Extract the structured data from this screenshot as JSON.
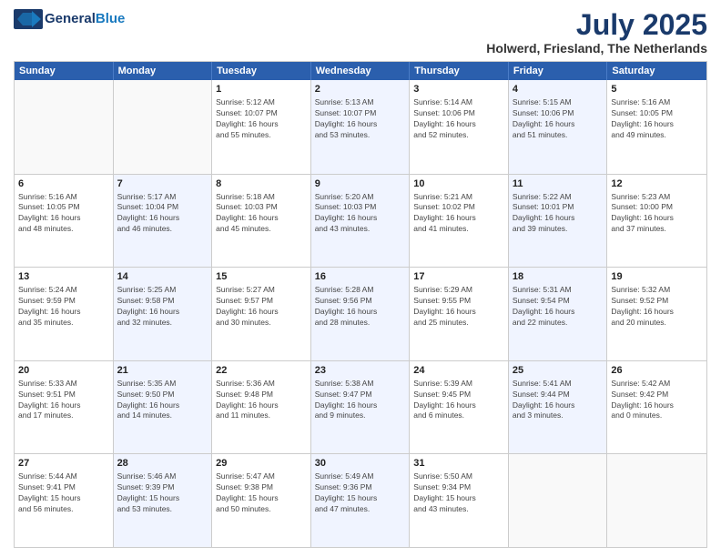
{
  "header": {
    "logo_general": "General",
    "logo_blue": "Blue",
    "month_title": "July 2025",
    "location": "Holwerd, Friesland, The Netherlands"
  },
  "weekdays": [
    "Sunday",
    "Monday",
    "Tuesday",
    "Wednesday",
    "Thursday",
    "Friday",
    "Saturday"
  ],
  "rows": [
    [
      {
        "num": "",
        "text": "",
        "empty": true
      },
      {
        "num": "",
        "text": "",
        "empty": true
      },
      {
        "num": "1",
        "text": "Sunrise: 5:12 AM\nSunset: 10:07 PM\nDaylight: 16 hours\nand 55 minutes.",
        "shade": false
      },
      {
        "num": "2",
        "text": "Sunrise: 5:13 AM\nSunset: 10:07 PM\nDaylight: 16 hours\nand 53 minutes.",
        "shade": true
      },
      {
        "num": "3",
        "text": "Sunrise: 5:14 AM\nSunset: 10:06 PM\nDaylight: 16 hours\nand 52 minutes.",
        "shade": false
      },
      {
        "num": "4",
        "text": "Sunrise: 5:15 AM\nSunset: 10:06 PM\nDaylight: 16 hours\nand 51 minutes.",
        "shade": true
      },
      {
        "num": "5",
        "text": "Sunrise: 5:16 AM\nSunset: 10:05 PM\nDaylight: 16 hours\nand 49 minutes.",
        "shade": false
      }
    ],
    [
      {
        "num": "6",
        "text": "Sunrise: 5:16 AM\nSunset: 10:05 PM\nDaylight: 16 hours\nand 48 minutes.",
        "shade": false
      },
      {
        "num": "7",
        "text": "Sunrise: 5:17 AM\nSunset: 10:04 PM\nDaylight: 16 hours\nand 46 minutes.",
        "shade": true
      },
      {
        "num": "8",
        "text": "Sunrise: 5:18 AM\nSunset: 10:03 PM\nDaylight: 16 hours\nand 45 minutes.",
        "shade": false
      },
      {
        "num": "9",
        "text": "Sunrise: 5:20 AM\nSunset: 10:03 PM\nDaylight: 16 hours\nand 43 minutes.",
        "shade": true
      },
      {
        "num": "10",
        "text": "Sunrise: 5:21 AM\nSunset: 10:02 PM\nDaylight: 16 hours\nand 41 minutes.",
        "shade": false
      },
      {
        "num": "11",
        "text": "Sunrise: 5:22 AM\nSunset: 10:01 PM\nDaylight: 16 hours\nand 39 minutes.",
        "shade": true
      },
      {
        "num": "12",
        "text": "Sunrise: 5:23 AM\nSunset: 10:00 PM\nDaylight: 16 hours\nand 37 minutes.",
        "shade": false
      }
    ],
    [
      {
        "num": "13",
        "text": "Sunrise: 5:24 AM\nSunset: 9:59 PM\nDaylight: 16 hours\nand 35 minutes.",
        "shade": false
      },
      {
        "num": "14",
        "text": "Sunrise: 5:25 AM\nSunset: 9:58 PM\nDaylight: 16 hours\nand 32 minutes.",
        "shade": true
      },
      {
        "num": "15",
        "text": "Sunrise: 5:27 AM\nSunset: 9:57 PM\nDaylight: 16 hours\nand 30 minutes.",
        "shade": false
      },
      {
        "num": "16",
        "text": "Sunrise: 5:28 AM\nSunset: 9:56 PM\nDaylight: 16 hours\nand 28 minutes.",
        "shade": true
      },
      {
        "num": "17",
        "text": "Sunrise: 5:29 AM\nSunset: 9:55 PM\nDaylight: 16 hours\nand 25 minutes.",
        "shade": false
      },
      {
        "num": "18",
        "text": "Sunrise: 5:31 AM\nSunset: 9:54 PM\nDaylight: 16 hours\nand 22 minutes.",
        "shade": true
      },
      {
        "num": "19",
        "text": "Sunrise: 5:32 AM\nSunset: 9:52 PM\nDaylight: 16 hours\nand 20 minutes.",
        "shade": false
      }
    ],
    [
      {
        "num": "20",
        "text": "Sunrise: 5:33 AM\nSunset: 9:51 PM\nDaylight: 16 hours\nand 17 minutes.",
        "shade": false
      },
      {
        "num": "21",
        "text": "Sunrise: 5:35 AM\nSunset: 9:50 PM\nDaylight: 16 hours\nand 14 minutes.",
        "shade": true
      },
      {
        "num": "22",
        "text": "Sunrise: 5:36 AM\nSunset: 9:48 PM\nDaylight: 16 hours\nand 11 minutes.",
        "shade": false
      },
      {
        "num": "23",
        "text": "Sunrise: 5:38 AM\nSunset: 9:47 PM\nDaylight: 16 hours\nand 9 minutes.",
        "shade": true
      },
      {
        "num": "24",
        "text": "Sunrise: 5:39 AM\nSunset: 9:45 PM\nDaylight: 16 hours\nand 6 minutes.",
        "shade": false
      },
      {
        "num": "25",
        "text": "Sunrise: 5:41 AM\nSunset: 9:44 PM\nDaylight: 16 hours\nand 3 minutes.",
        "shade": true
      },
      {
        "num": "26",
        "text": "Sunrise: 5:42 AM\nSunset: 9:42 PM\nDaylight: 16 hours\nand 0 minutes.",
        "shade": false
      }
    ],
    [
      {
        "num": "27",
        "text": "Sunrise: 5:44 AM\nSunset: 9:41 PM\nDaylight: 15 hours\nand 56 minutes.",
        "shade": false
      },
      {
        "num": "28",
        "text": "Sunrise: 5:46 AM\nSunset: 9:39 PM\nDaylight: 15 hours\nand 53 minutes.",
        "shade": true
      },
      {
        "num": "29",
        "text": "Sunrise: 5:47 AM\nSunset: 9:38 PM\nDaylight: 15 hours\nand 50 minutes.",
        "shade": false
      },
      {
        "num": "30",
        "text": "Sunrise: 5:49 AM\nSunset: 9:36 PM\nDaylight: 15 hours\nand 47 minutes.",
        "shade": true
      },
      {
        "num": "31",
        "text": "Sunrise: 5:50 AM\nSunset: 9:34 PM\nDaylight: 15 hours\nand 43 minutes.",
        "shade": false
      },
      {
        "num": "",
        "text": "",
        "empty": true
      },
      {
        "num": "",
        "text": "",
        "empty": true
      }
    ]
  ]
}
